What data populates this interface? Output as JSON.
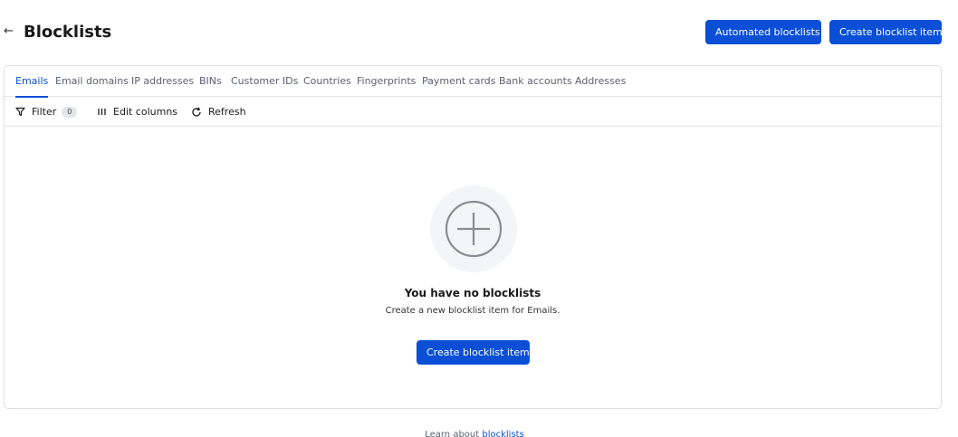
{
  "header": {
    "title": "Blocklists",
    "back_icon": "arrow-left-icon",
    "automated_label": "Automated blocklists",
    "create_label": "Create blocklist item"
  },
  "tabs": [
    {
      "label": "Emails",
      "active": true
    },
    {
      "label": "Email domains",
      "active": false
    },
    {
      "label": "IP addresses",
      "active": false
    },
    {
      "label": "BINs",
      "active": false
    },
    {
      "label": "Customer IDs",
      "active": false
    },
    {
      "label": "Countries",
      "active": false
    },
    {
      "label": "Fingerprints",
      "active": false
    },
    {
      "label": "Payment cards",
      "active": false
    },
    {
      "label": "Bank accounts",
      "active": false
    },
    {
      "label": "Addresses",
      "active": false
    }
  ],
  "toolbar": {
    "filter_label": "Filter",
    "filter_count": "0",
    "edit_columns_label": "Edit columns",
    "refresh_label": "Refresh"
  },
  "empty_state": {
    "icon": "plus-circle-icon",
    "title": "You have no blocklists",
    "subtitle": "Create a new blocklist item for Emails.",
    "button_label": "Create blocklist item"
  },
  "footer": {
    "prefix": "Learn about",
    "link_label": "blocklists"
  },
  "colors": {
    "accent": "#0b4fd6",
    "border": "#dcdfe4",
    "muted_text": "#5b6270",
    "icon_circle_bg": "#f4f5f7"
  }
}
